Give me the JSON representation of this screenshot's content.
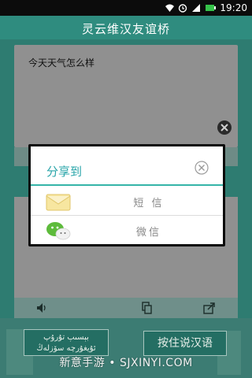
{
  "status_bar": {
    "time": "19:20"
  },
  "header": {
    "title": "灵云维汉友谊桥"
  },
  "input": {
    "text": "今天天气怎么样"
  },
  "dialog": {
    "title": "分享到",
    "items": [
      {
        "label": "短 信",
        "icon": "sms-envelope-icon"
      },
      {
        "label": "微信",
        "icon": "wechat-icon"
      }
    ]
  },
  "buttons": {
    "uyghur_line1": "بېسىپ تۇرۇپ",
    "uyghur_line2": "ئۇيغۇرچە سۆزلەڭ",
    "chinese": "按住说汉语"
  },
  "watermark": "新意手游 • SJXINYI.COM",
  "colors": {
    "accent": "#2f8c7f",
    "dialog_accent": "#35b4a8"
  }
}
